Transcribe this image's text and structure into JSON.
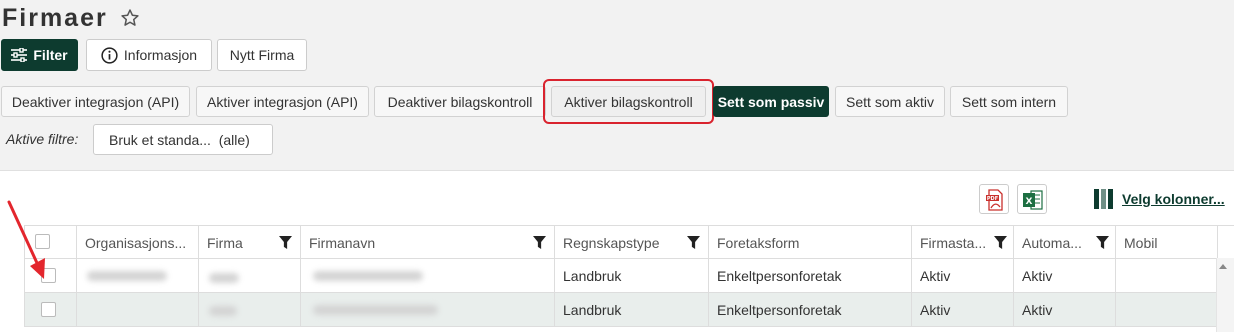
{
  "header": {
    "title": "Firmaer"
  },
  "toolbar": {
    "filter_label": "Filter",
    "info_label": "Informasjon",
    "new_company_label": "Nytt Firma"
  },
  "actions": {
    "deactivate_integration": "Deaktiver integrasjon (API)",
    "activate_integration": "Aktiver integrasjon (API)",
    "deactivate_voucher_control": "Deaktiver bilagskontroll",
    "activate_voucher_control": "Aktiver bilagskontroll",
    "set_passive": "Sett som passiv",
    "set_active": "Sett som aktiv",
    "set_internal": "Sett som intern"
  },
  "filters": {
    "label": "Aktive filtre:",
    "chip": "Bruk et standa...  (alle)"
  },
  "export": {
    "columns_link": "Velg kolonner..."
  },
  "table": {
    "headers": [
      "Organisasjons...",
      "Firma",
      "Firmanavn",
      "Regnskapstype",
      "Foretaksform",
      "Firmasta...",
      "Automa...",
      "Mobil"
    ],
    "rows": [
      {
        "regnskapstype": "Landbruk",
        "foretaksform": "Enkeltpersonforetak",
        "firmastatus": "Aktiv",
        "automatisk": "Aktiv"
      },
      {
        "regnskapstype": "Landbruk",
        "foretaksform": "Enkeltpersonforetak",
        "firmastatus": "Aktiv",
        "automatisk": "Aktiv"
      }
    ]
  },
  "colors": {
    "primary": "#0d3b2f",
    "highlight": "#d9232e",
    "selected_row": "#e9eeec"
  }
}
